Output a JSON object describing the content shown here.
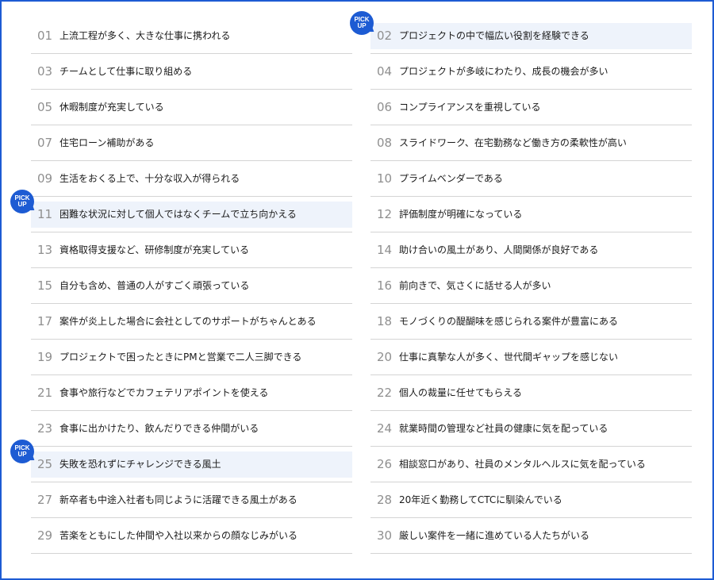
{
  "badge": {
    "line1": "PICK",
    "line2": "UP"
  },
  "items": [
    {
      "num": "01",
      "text": "上流工程が多く、大きな仕事に携われる",
      "pick": false
    },
    {
      "num": "02",
      "text": "プロジェクトの中で幅広い役割を経験できる",
      "pick": true
    },
    {
      "num": "03",
      "text": "チームとして仕事に取り組める",
      "pick": false
    },
    {
      "num": "04",
      "text": "プロジェクトが多岐にわたり、成長の機会が多い",
      "pick": false
    },
    {
      "num": "05",
      "text": "休暇制度が充実している",
      "pick": false
    },
    {
      "num": "06",
      "text": "コンプライアンスを重視している",
      "pick": false
    },
    {
      "num": "07",
      "text": "住宅ローン補助がある",
      "pick": false
    },
    {
      "num": "08",
      "text": "スライドワーク、在宅勤務など働き方の柔軟性が高い",
      "pick": false
    },
    {
      "num": "09",
      "text": "生活をおくる上で、十分な収入が得られる",
      "pick": false
    },
    {
      "num": "10",
      "text": "プライムベンダーである",
      "pick": false
    },
    {
      "num": "11",
      "text": "困難な状況に対して個人ではなくチームで立ち向かえる",
      "pick": true
    },
    {
      "num": "12",
      "text": "評価制度が明確になっている",
      "pick": false
    },
    {
      "num": "13",
      "text": "資格取得支援など、研修制度が充実している",
      "pick": false
    },
    {
      "num": "14",
      "text": "助け合いの風土があり、人間関係が良好である",
      "pick": false
    },
    {
      "num": "15",
      "text": "自分も含め、普通の人がすごく頑張っている",
      "pick": false
    },
    {
      "num": "16",
      "text": "前向きで、気さくに話せる人が多い",
      "pick": false
    },
    {
      "num": "17",
      "text": "案件が炎上した場合に会社としてのサポートがちゃんとある",
      "pick": false
    },
    {
      "num": "18",
      "text": "モノづくりの醍醐味を感じられる案件が豊富にある",
      "pick": false
    },
    {
      "num": "19",
      "text": "プロジェクトで困ったときにPMと営業で二人三脚できる",
      "pick": false
    },
    {
      "num": "20",
      "text": "仕事に真摯な人が多く、世代間ギャップを感じない",
      "pick": false
    },
    {
      "num": "21",
      "text": "食事や旅行などでカフェテリアポイントを使える",
      "pick": false
    },
    {
      "num": "22",
      "text": "個人の裁量に任せてもらえる",
      "pick": false
    },
    {
      "num": "23",
      "text": "食事に出かけたり、飲んだりできる仲間がいる",
      "pick": false
    },
    {
      "num": "24",
      "text": "就業時間の管理など社員の健康に気を配っている",
      "pick": false
    },
    {
      "num": "25",
      "text": "失敗を恐れずにチャレンジできる風土",
      "pick": true
    },
    {
      "num": "26",
      "text": "相談窓口があり、社員のメンタルヘルスに気を配っている",
      "pick": false
    },
    {
      "num": "27",
      "text": "新卒者も中途入社者も同じように活躍できる風土がある",
      "pick": false
    },
    {
      "num": "28",
      "text": "20年近く勤務してCTCに馴染んでいる",
      "pick": false
    },
    {
      "num": "29",
      "text": "苦楽をともにした仲間や入社以来からの顔なじみがいる",
      "pick": false
    },
    {
      "num": "30",
      "text": "厳しい案件を一緒に進めている人たちがいる",
      "pick": false
    }
  ]
}
